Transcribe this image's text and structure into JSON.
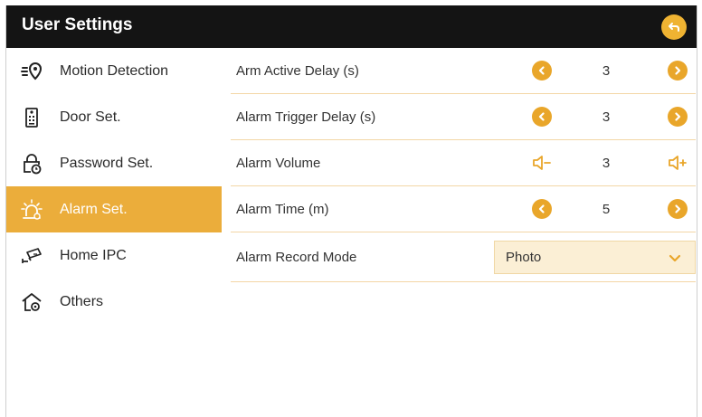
{
  "header": {
    "title": "User Settings"
  },
  "sidebar": {
    "items": [
      {
        "label": "Motion Detection",
        "icon": "motion-detection-icon"
      },
      {
        "label": "Door Set.",
        "icon": "door-station-icon"
      },
      {
        "label": "Password Set.",
        "icon": "password-lock-icon"
      },
      {
        "label": "Alarm Set.",
        "icon": "alarm-light-icon",
        "active": true
      },
      {
        "label": "Home IPC",
        "icon": "ip-camera-icon"
      },
      {
        "label": "Others",
        "icon": "home-gear-icon"
      }
    ]
  },
  "settings": {
    "arm_active_delay": {
      "label": "Arm Active Delay (s)",
      "value": "3"
    },
    "alarm_trigger_delay": {
      "label": "Alarm Trigger Delay (s)",
      "value": "3"
    },
    "alarm_volume": {
      "label": "Alarm Volume",
      "value": "3"
    },
    "alarm_time": {
      "label": "Alarm Time (m)",
      "value": "5"
    },
    "alarm_record_mode": {
      "label": "Alarm Record Mode",
      "value": "Photo"
    }
  },
  "colors": {
    "accent": "#ebad3b",
    "header_bg": "#141414",
    "divider": "#f3d6a6"
  }
}
